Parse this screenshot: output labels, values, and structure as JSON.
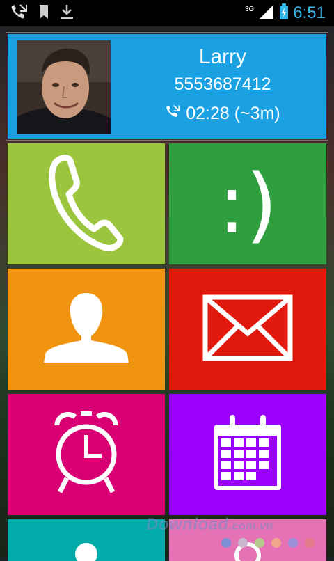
{
  "status_bar": {
    "network": "3G",
    "time": "6:51",
    "accent_color": "#33b5e5"
  },
  "contact": {
    "name": "Larry",
    "number": "5553687412",
    "duration": "02:28 (~3m)",
    "card_color": "#1ba1e2"
  },
  "tiles": [
    {
      "name": "phone",
      "icon": "phone-icon",
      "color": "#9bc53d"
    },
    {
      "name": "emoticon",
      "label": ":)",
      "color": "#2e9e3e"
    },
    {
      "name": "contacts",
      "icon": "person-icon",
      "color": "#f0930f"
    },
    {
      "name": "messages",
      "icon": "envelope-icon",
      "color": "#e0190c"
    },
    {
      "name": "alarm",
      "icon": "alarm-clock-icon",
      "color": "#d80073"
    },
    {
      "name": "calendar",
      "icon": "calendar-icon",
      "color": "#9b00ff"
    },
    {
      "name": "partial-left",
      "icon": "person-icon",
      "color": "#00aba9"
    },
    {
      "name": "partial-right",
      "icon": "search-icon",
      "color": "#e472b4"
    }
  ],
  "watermark": {
    "text": "Download",
    "suffix": ".com.vn"
  },
  "watermark_dots": [
    "#7b8fd6",
    "#c9b6cf",
    "#b7c98f",
    "#f0a68a",
    "#9b8fd6",
    "#e27a8a"
  ]
}
